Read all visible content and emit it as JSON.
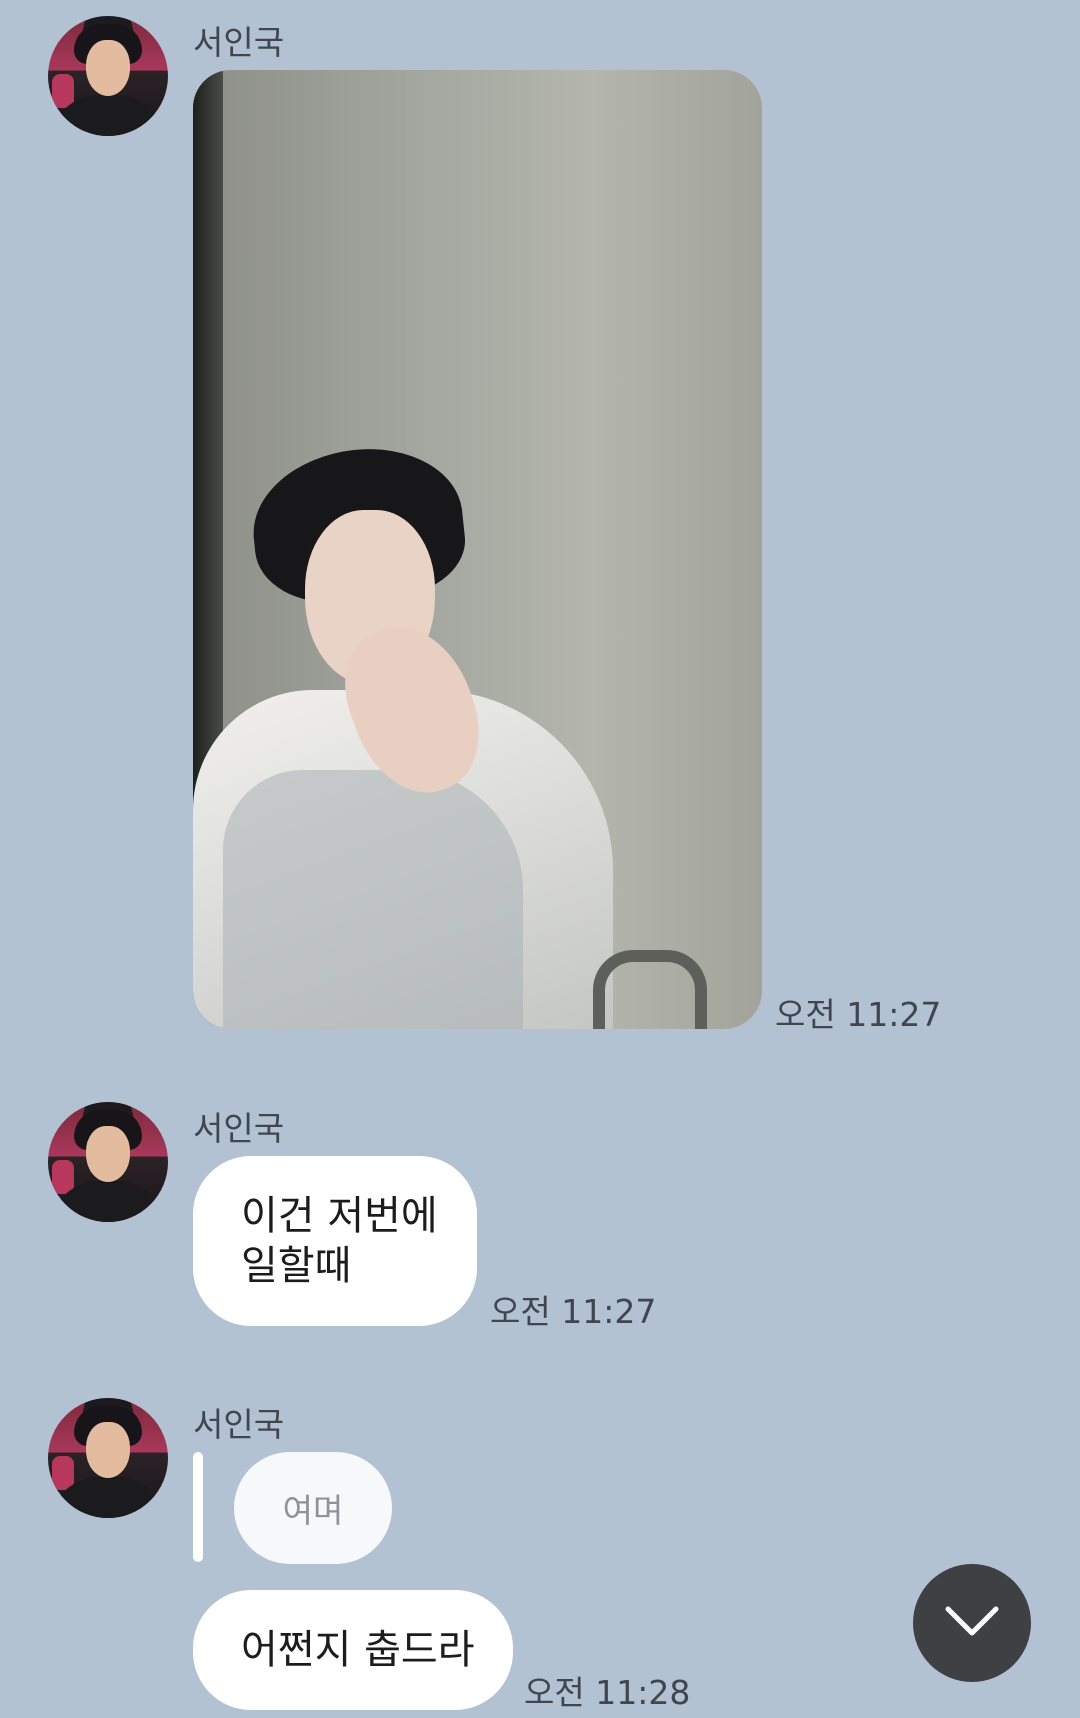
{
  "messages": [
    {
      "sender": "서인국",
      "type": "photo",
      "time": "오전 11:27"
    },
    {
      "sender": "서인국",
      "type": "text",
      "lines": [
        "이건 저번에",
        "일할때"
      ],
      "time": "오전 11:27"
    },
    {
      "sender": "서인국",
      "type": "reply",
      "quoted": "여며",
      "text": "어쩐지 춥드라",
      "time": "오전 11:28"
    }
  ],
  "icons": {
    "scroll_down": "chevron-down-icon"
  },
  "colors": {
    "background": "#b2c2d3",
    "bubble": "#ffffff",
    "scroll_button": "#3e4044"
  }
}
